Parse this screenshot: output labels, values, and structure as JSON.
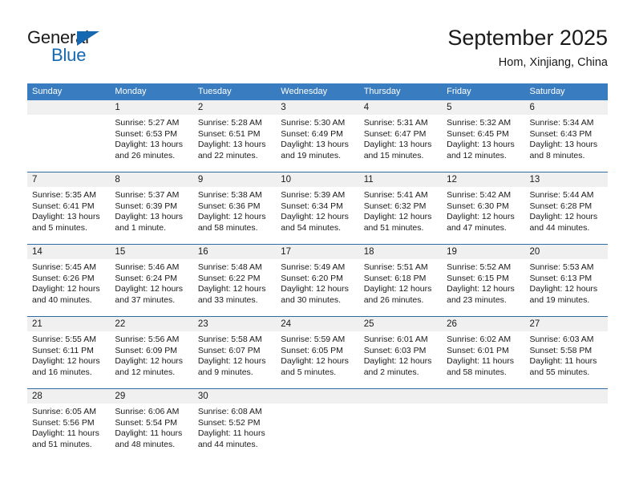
{
  "brand": {
    "name_part1": "General",
    "name_part2": "Blue",
    "triangle_icon": "triangle-icon",
    "accent_color": "#1669b0"
  },
  "header": {
    "title": "September 2025",
    "subtitle": "Hom, Xinjiang, China"
  },
  "theme": {
    "header_row_bg": "#3a7cc0",
    "week_divider": "#2e6da4",
    "daynum_band_bg": "#f0f0f0",
    "text": "#1a1a1a"
  },
  "weekdays": [
    "Sunday",
    "Monday",
    "Tuesday",
    "Wednesday",
    "Thursday",
    "Friday",
    "Saturday"
  ],
  "weeks": [
    [
      {
        "day": "",
        "empty": true,
        "sunrise": "",
        "sunset": "",
        "daylight_1": "",
        "daylight_2": ""
      },
      {
        "day": "1",
        "sunrise": "Sunrise: 5:27 AM",
        "sunset": "Sunset: 6:53 PM",
        "daylight_1": "Daylight: 13 hours",
        "daylight_2": "and 26 minutes."
      },
      {
        "day": "2",
        "sunrise": "Sunrise: 5:28 AM",
        "sunset": "Sunset: 6:51 PM",
        "daylight_1": "Daylight: 13 hours",
        "daylight_2": "and 22 minutes."
      },
      {
        "day": "3",
        "sunrise": "Sunrise: 5:30 AM",
        "sunset": "Sunset: 6:49 PM",
        "daylight_1": "Daylight: 13 hours",
        "daylight_2": "and 19 minutes."
      },
      {
        "day": "4",
        "sunrise": "Sunrise: 5:31 AM",
        "sunset": "Sunset: 6:47 PM",
        "daylight_1": "Daylight: 13 hours",
        "daylight_2": "and 15 minutes."
      },
      {
        "day": "5",
        "sunrise": "Sunrise: 5:32 AM",
        "sunset": "Sunset: 6:45 PM",
        "daylight_1": "Daylight: 13 hours",
        "daylight_2": "and 12 minutes."
      },
      {
        "day": "6",
        "sunrise": "Sunrise: 5:34 AM",
        "sunset": "Sunset: 6:43 PM",
        "daylight_1": "Daylight: 13 hours",
        "daylight_2": "and 8 minutes."
      }
    ],
    [
      {
        "day": "7",
        "sunrise": "Sunrise: 5:35 AM",
        "sunset": "Sunset: 6:41 PM",
        "daylight_1": "Daylight: 13 hours",
        "daylight_2": "and 5 minutes."
      },
      {
        "day": "8",
        "sunrise": "Sunrise: 5:37 AM",
        "sunset": "Sunset: 6:39 PM",
        "daylight_1": "Daylight: 13 hours",
        "daylight_2": "and 1 minute."
      },
      {
        "day": "9",
        "sunrise": "Sunrise: 5:38 AM",
        "sunset": "Sunset: 6:36 PM",
        "daylight_1": "Daylight: 12 hours",
        "daylight_2": "and 58 minutes."
      },
      {
        "day": "10",
        "sunrise": "Sunrise: 5:39 AM",
        "sunset": "Sunset: 6:34 PM",
        "daylight_1": "Daylight: 12 hours",
        "daylight_2": "and 54 minutes."
      },
      {
        "day": "11",
        "sunrise": "Sunrise: 5:41 AM",
        "sunset": "Sunset: 6:32 PM",
        "daylight_1": "Daylight: 12 hours",
        "daylight_2": "and 51 minutes."
      },
      {
        "day": "12",
        "sunrise": "Sunrise: 5:42 AM",
        "sunset": "Sunset: 6:30 PM",
        "daylight_1": "Daylight: 12 hours",
        "daylight_2": "and 47 minutes."
      },
      {
        "day": "13",
        "sunrise": "Sunrise: 5:44 AM",
        "sunset": "Sunset: 6:28 PM",
        "daylight_1": "Daylight: 12 hours",
        "daylight_2": "and 44 minutes."
      }
    ],
    [
      {
        "day": "14",
        "sunrise": "Sunrise: 5:45 AM",
        "sunset": "Sunset: 6:26 PM",
        "daylight_1": "Daylight: 12 hours",
        "daylight_2": "and 40 minutes."
      },
      {
        "day": "15",
        "sunrise": "Sunrise: 5:46 AM",
        "sunset": "Sunset: 6:24 PM",
        "daylight_1": "Daylight: 12 hours",
        "daylight_2": "and 37 minutes."
      },
      {
        "day": "16",
        "sunrise": "Sunrise: 5:48 AM",
        "sunset": "Sunset: 6:22 PM",
        "daylight_1": "Daylight: 12 hours",
        "daylight_2": "and 33 minutes."
      },
      {
        "day": "17",
        "sunrise": "Sunrise: 5:49 AM",
        "sunset": "Sunset: 6:20 PM",
        "daylight_1": "Daylight: 12 hours",
        "daylight_2": "and 30 minutes."
      },
      {
        "day": "18",
        "sunrise": "Sunrise: 5:51 AM",
        "sunset": "Sunset: 6:18 PM",
        "daylight_1": "Daylight: 12 hours",
        "daylight_2": "and 26 minutes."
      },
      {
        "day": "19",
        "sunrise": "Sunrise: 5:52 AM",
        "sunset": "Sunset: 6:15 PM",
        "daylight_1": "Daylight: 12 hours",
        "daylight_2": "and 23 minutes."
      },
      {
        "day": "20",
        "sunrise": "Sunrise: 5:53 AM",
        "sunset": "Sunset: 6:13 PM",
        "daylight_1": "Daylight: 12 hours",
        "daylight_2": "and 19 minutes."
      }
    ],
    [
      {
        "day": "21",
        "sunrise": "Sunrise: 5:55 AM",
        "sunset": "Sunset: 6:11 PM",
        "daylight_1": "Daylight: 12 hours",
        "daylight_2": "and 16 minutes."
      },
      {
        "day": "22",
        "sunrise": "Sunrise: 5:56 AM",
        "sunset": "Sunset: 6:09 PM",
        "daylight_1": "Daylight: 12 hours",
        "daylight_2": "and 12 minutes."
      },
      {
        "day": "23",
        "sunrise": "Sunrise: 5:58 AM",
        "sunset": "Sunset: 6:07 PM",
        "daylight_1": "Daylight: 12 hours",
        "daylight_2": "and 9 minutes."
      },
      {
        "day": "24",
        "sunrise": "Sunrise: 5:59 AM",
        "sunset": "Sunset: 6:05 PM",
        "daylight_1": "Daylight: 12 hours",
        "daylight_2": "and 5 minutes."
      },
      {
        "day": "25",
        "sunrise": "Sunrise: 6:01 AM",
        "sunset": "Sunset: 6:03 PM",
        "daylight_1": "Daylight: 12 hours",
        "daylight_2": "and 2 minutes."
      },
      {
        "day": "26",
        "sunrise": "Sunrise: 6:02 AM",
        "sunset": "Sunset: 6:01 PM",
        "daylight_1": "Daylight: 11 hours",
        "daylight_2": "and 58 minutes."
      },
      {
        "day": "27",
        "sunrise": "Sunrise: 6:03 AM",
        "sunset": "Sunset: 5:58 PM",
        "daylight_1": "Daylight: 11 hours",
        "daylight_2": "and 55 minutes."
      }
    ],
    [
      {
        "day": "28",
        "sunrise": "Sunrise: 6:05 AM",
        "sunset": "Sunset: 5:56 PM",
        "daylight_1": "Daylight: 11 hours",
        "daylight_2": "and 51 minutes."
      },
      {
        "day": "29",
        "sunrise": "Sunrise: 6:06 AM",
        "sunset": "Sunset: 5:54 PM",
        "daylight_1": "Daylight: 11 hours",
        "daylight_2": "and 48 minutes."
      },
      {
        "day": "30",
        "sunrise": "Sunrise: 6:08 AM",
        "sunset": "Sunset: 5:52 PM",
        "daylight_1": "Daylight: 11 hours",
        "daylight_2": "and 44 minutes."
      },
      {
        "day": "",
        "empty": true,
        "sunrise": "",
        "sunset": "",
        "daylight_1": "",
        "daylight_2": ""
      },
      {
        "day": "",
        "empty": true,
        "sunrise": "",
        "sunset": "",
        "daylight_1": "",
        "daylight_2": ""
      },
      {
        "day": "",
        "empty": true,
        "sunrise": "",
        "sunset": "",
        "daylight_1": "",
        "daylight_2": ""
      },
      {
        "day": "",
        "empty": true,
        "sunrise": "",
        "sunset": "",
        "daylight_1": "",
        "daylight_2": ""
      }
    ]
  ]
}
